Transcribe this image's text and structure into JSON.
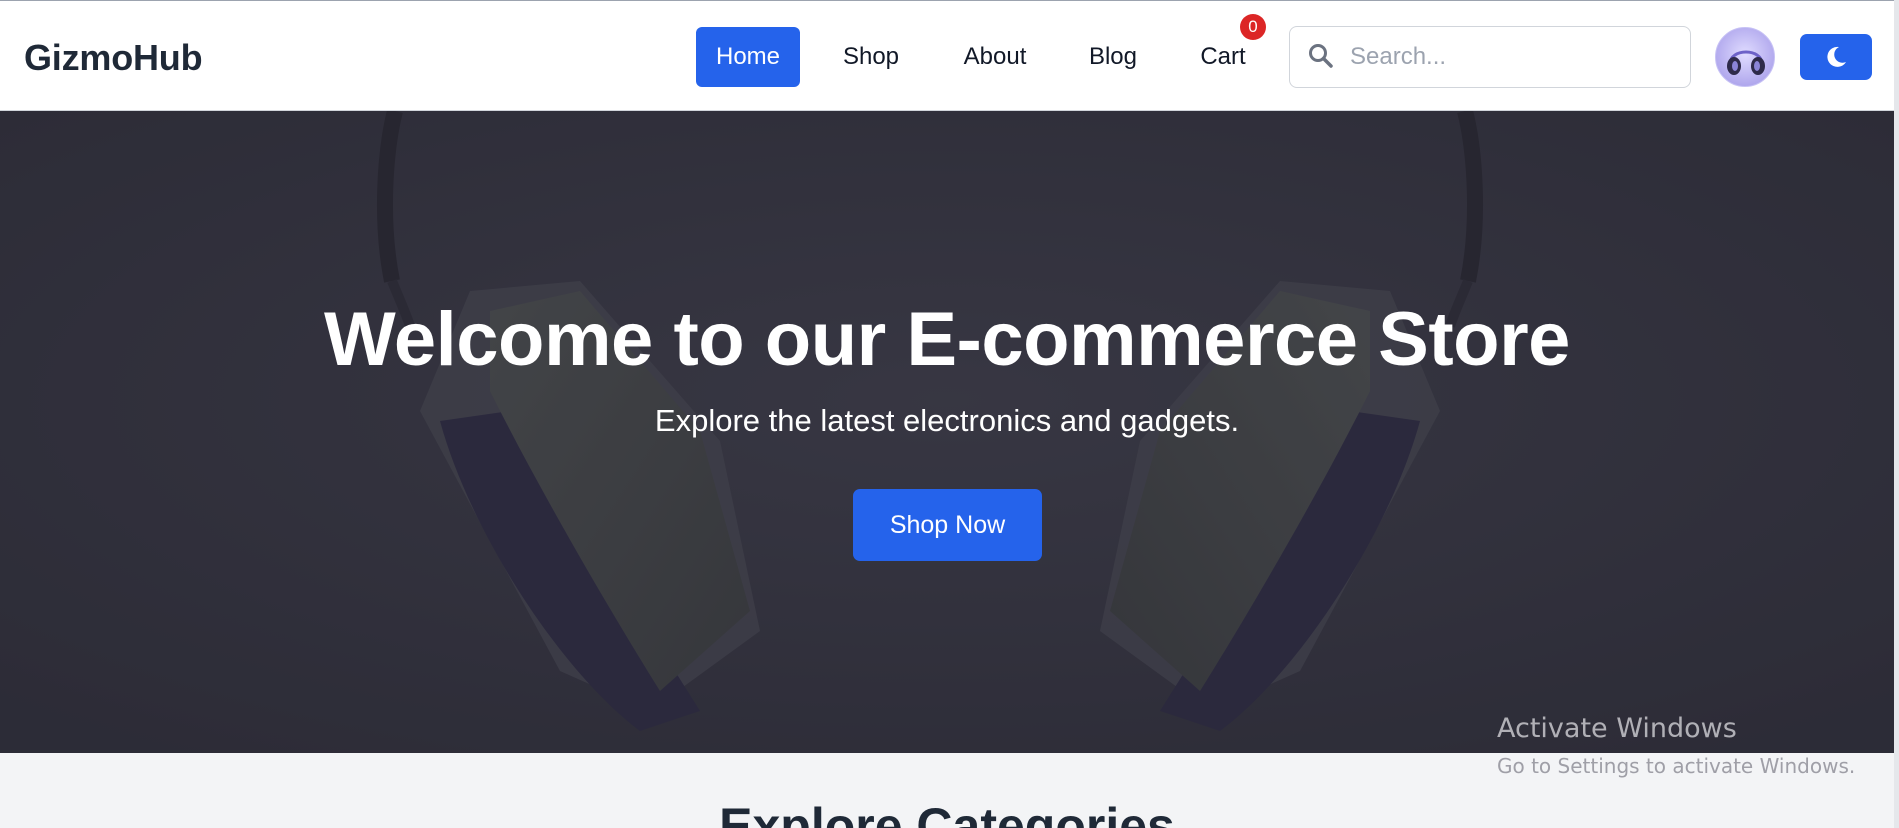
{
  "header": {
    "brand": "GizmoHub",
    "nav": [
      {
        "label": "Home",
        "active": true
      },
      {
        "label": "Shop",
        "active": false
      },
      {
        "label": "About",
        "active": false
      },
      {
        "label": "Blog",
        "active": false
      },
      {
        "label": "Cart",
        "active": false
      }
    ],
    "cart_count": "0",
    "search": {
      "placeholder": "Search...",
      "value": ""
    },
    "avatar_icon": "headphones-avatar-icon",
    "theme_toggle_icon": "moon-icon"
  },
  "hero": {
    "title": "Welcome to our E-commerce Store",
    "subtitle": "Explore the latest electronics and gadgets.",
    "cta": "Shop Now"
  },
  "categories": {
    "title": "Explore Categories"
  },
  "watermark": {
    "line1": "Activate Windows",
    "line2": "Go to Settings to activate Windows."
  },
  "colors": {
    "accent": "#2563eb",
    "badge": "#dc2626",
    "hero_overlay": "#3b3a47",
    "section_bg": "#f3f4f6"
  }
}
